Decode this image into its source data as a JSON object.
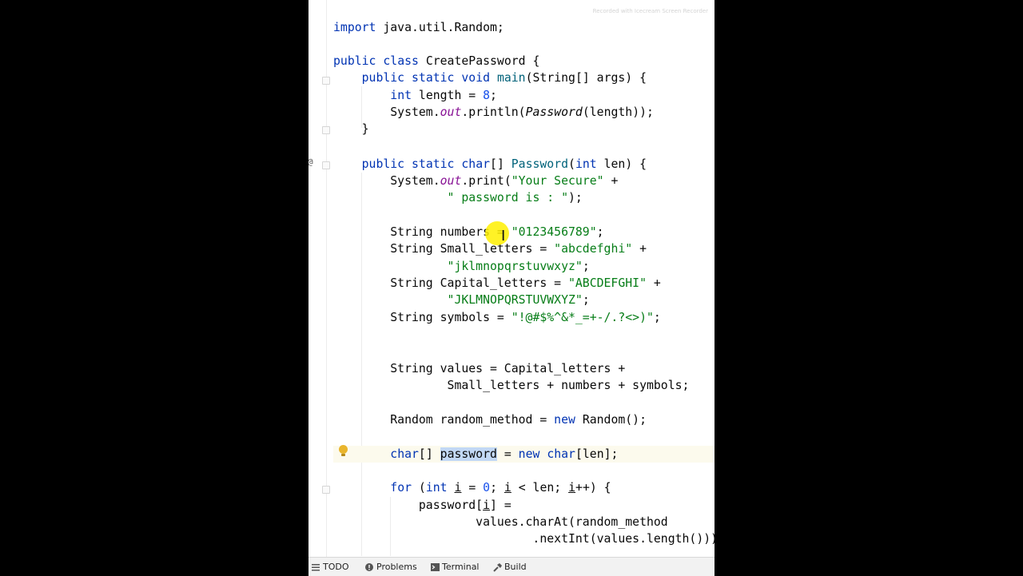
{
  "watermark": "Recorded with Icecream Screen Recorder",
  "editor": {
    "lines": [
      [
        {
          "t": "import",
          "c": "kw"
        },
        {
          "t": " java.util.Random;"
        }
      ],
      [
        {
          "t": "public",
          "c": "kw"
        },
        {
          "t": " "
        },
        {
          "t": "class",
          "c": "kw"
        },
        {
          "t": " CreatePassword {"
        }
      ],
      [
        {
          "t": "    "
        },
        {
          "t": "public",
          "c": "kw"
        },
        {
          "t": " "
        },
        {
          "t": "static",
          "c": "kw"
        },
        {
          "t": " "
        },
        {
          "t": "void",
          "c": "kw"
        },
        {
          "t": " "
        },
        {
          "t": "main",
          "c": "mtd"
        },
        {
          "t": "(String[] args) {"
        }
      ],
      [
        {
          "t": "        "
        },
        {
          "t": "int",
          "c": "kw"
        },
        {
          "t": " length = "
        },
        {
          "t": "8",
          "c": "num"
        },
        {
          "t": ";"
        }
      ],
      [
        {
          "t": "        System."
        },
        {
          "t": "out",
          "c": "fld"
        },
        {
          "t": ".println("
        },
        {
          "t": "Password",
          "c": "it"
        },
        {
          "t": "(length));"
        }
      ],
      [
        {
          "t": "    }"
        }
      ],
      [
        {
          "t": "    "
        },
        {
          "t": "public",
          "c": "kw"
        },
        {
          "t": " "
        },
        {
          "t": "static",
          "c": "kw"
        },
        {
          "t": " "
        },
        {
          "t": "char",
          "c": "kw"
        },
        {
          "t": "[] "
        },
        {
          "t": "Password",
          "c": "mtd"
        },
        {
          "t": "("
        },
        {
          "t": "int",
          "c": "kw"
        },
        {
          "t": " len) {"
        }
      ],
      [
        {
          "t": "        System."
        },
        {
          "t": "out",
          "c": "fld"
        },
        {
          "t": ".print("
        },
        {
          "t": "\"Your Secure\"",
          "c": "str"
        },
        {
          "t": " +"
        }
      ],
      [
        {
          "t": "                "
        },
        {
          "t": "\" password is : \"",
          "c": "str"
        },
        {
          "t": ");"
        }
      ],
      [
        {
          "t": "        String numbers = "
        },
        {
          "t": "\"0123456789\"",
          "c": "str"
        },
        {
          "t": ";"
        }
      ],
      [
        {
          "t": "        String Small_letters = "
        },
        {
          "t": "\"abcdefghi\"",
          "c": "str"
        },
        {
          "t": " +"
        }
      ],
      [
        {
          "t": "                "
        },
        {
          "t": "\"jklmnopqrstuvwxyz\"",
          "c": "str"
        },
        {
          "t": ";"
        }
      ],
      [
        {
          "t": "        String Capital_letters = "
        },
        {
          "t": "\"ABCDEFGHI\"",
          "c": "str"
        },
        {
          "t": " +"
        }
      ],
      [
        {
          "t": "                "
        },
        {
          "t": "\"JKLMNOPQRSTUVWXYZ\"",
          "c": "str"
        },
        {
          "t": ";"
        }
      ],
      [
        {
          "t": "        String symbols = "
        },
        {
          "t": "\"!@#$%^&*_=+-/.?<>)\"",
          "c": "str"
        },
        {
          "t": ";"
        }
      ],
      [
        {
          "t": "        String values = Capital_letters +"
        }
      ],
      [
        {
          "t": "                Small_letters + numbers + symbols;"
        }
      ],
      [
        {
          "t": "        Random random_method = "
        },
        {
          "t": "new",
          "c": "kw"
        },
        {
          "t": " Random();"
        }
      ],
      [
        {
          "t": "        "
        },
        {
          "t": "char",
          "c": "kw"
        },
        {
          "t": "[] "
        },
        {
          "t": "password",
          "c": "hl"
        },
        {
          "t": " = "
        },
        {
          "t": "new",
          "c": "kw"
        },
        {
          "t": " "
        },
        {
          "t": "char",
          "c": "kw"
        },
        {
          "t": "[len];"
        }
      ],
      [
        {
          "t": "        "
        },
        {
          "t": "for",
          "c": "kw"
        },
        {
          "t": " ("
        },
        {
          "t": "int",
          "c": "kw"
        },
        {
          "t": " "
        },
        {
          "t": "i",
          "c": "ul"
        },
        {
          "t": " = "
        },
        {
          "t": "0",
          "c": "num"
        },
        {
          "t": "; "
        },
        {
          "t": "i",
          "c": "ul"
        },
        {
          "t": " < len; "
        },
        {
          "t": "i",
          "c": "ul"
        },
        {
          "t": "++) {"
        }
      ],
      [
        {
          "t": "            password["
        },
        {
          "t": "i",
          "c": "ul"
        },
        {
          "t": "] ="
        }
      ],
      [
        {
          "t": "                    values.charAt(random_method"
        }
      ],
      [
        {
          "t": "                            .nextInt(values.length()));"
        }
      ]
    ]
  },
  "bottom_toolbar": {
    "todo": "TODO",
    "problems": "Problems",
    "terminal": "Terminal",
    "build": "Build"
  },
  "colors": {
    "keyword": "#0033b3",
    "string": "#067d17",
    "number": "#1750eb",
    "static_field": "#871094",
    "method_decl": "#00627a",
    "selection": "#c2d8f5",
    "current_line": "#fcfaed"
  },
  "icons": [
    "fold-marker-icon",
    "lightbulb-icon",
    "todo-icon",
    "problems-icon",
    "terminal-icon",
    "build-icon"
  ]
}
